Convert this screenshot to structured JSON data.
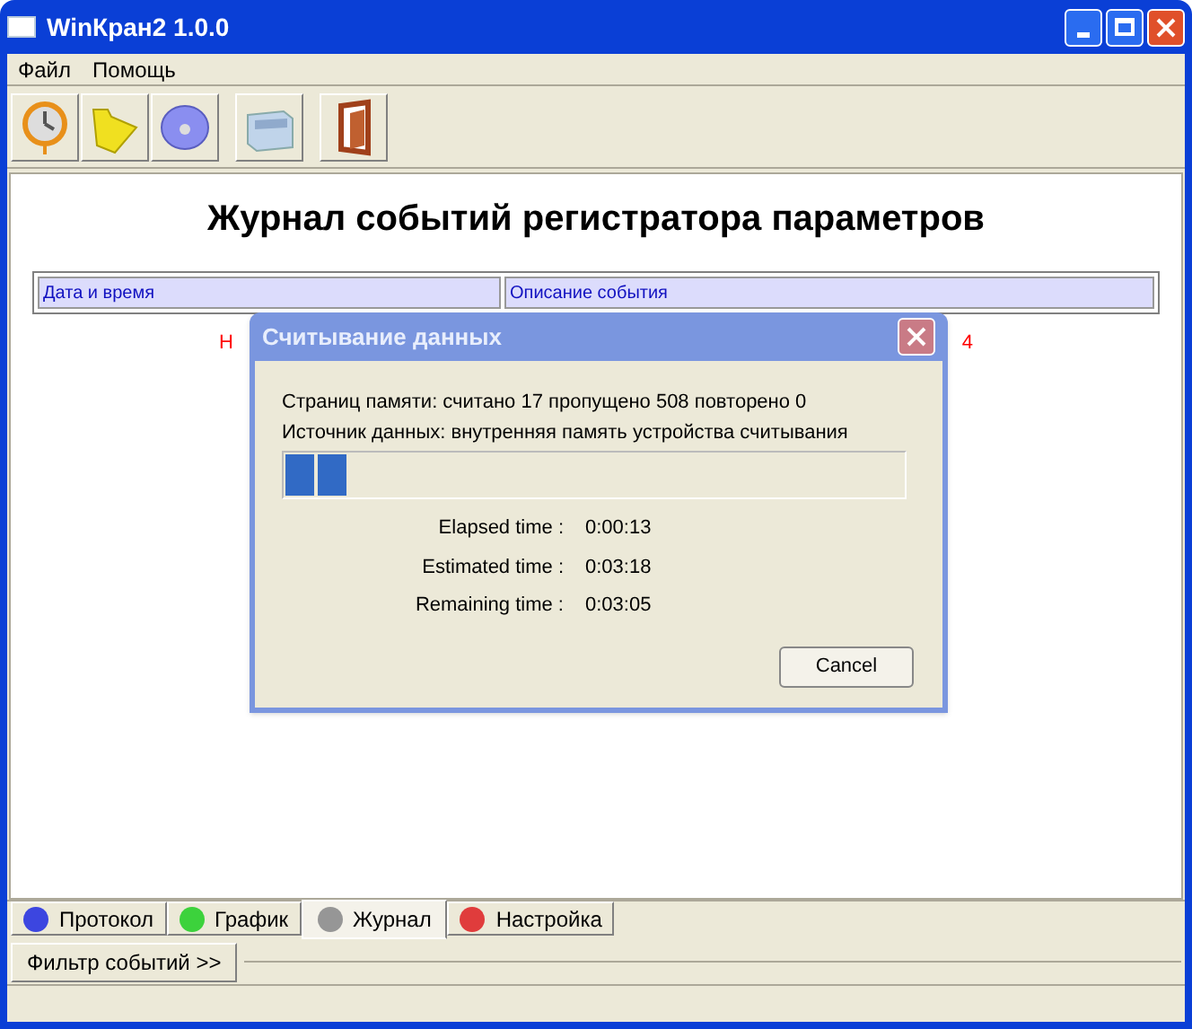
{
  "window": {
    "title": "WinКран2 1.0.0"
  },
  "menu": [
    "Файл",
    "Помощь"
  ],
  "toolbar": [
    {
      "kind": "clock"
    },
    {
      "kind": "folder"
    },
    {
      "kind": "disc"
    },
    {
      "kind": "box"
    },
    {
      "kind": "door"
    }
  ],
  "heading": "Журнал событий регистратора параметров",
  "table": {
    "columns": [
      "Дата и время",
      "Описание события"
    ]
  },
  "notice": {
    "left_fragment": "Н",
    "right_fragment": "4"
  },
  "dialog": {
    "title": "Считывание данных",
    "lines": [
      "Страниц памяти: считано 17 пропущено 508 повторено 0",
      "Источник данных: внутренняя память устройства считывания"
    ],
    "progress": {
      "level": 0.1
    },
    "times": [
      {
        "label": "Elapsed time :",
        "value": "0:00:13"
      },
      {
        "label": "Estimated time :",
        "value": "0:03:18"
      },
      {
        "label": "Remaining time :",
        "value": "0:03:05"
      }
    ],
    "button": "Cancel"
  },
  "tabs": [
    {
      "label": "Протокол",
      "color": "#3c46e0",
      "selected": false
    },
    {
      "label": "График",
      "color": "#3cd23c",
      "selected": false
    },
    {
      "label": "Журнал",
      "color": "#969696",
      "selected": true
    },
    {
      "label": "Настройка",
      "color": "#e03c3c",
      "selected": false
    }
  ],
  "filter_button": "Фильтр событий >>"
}
